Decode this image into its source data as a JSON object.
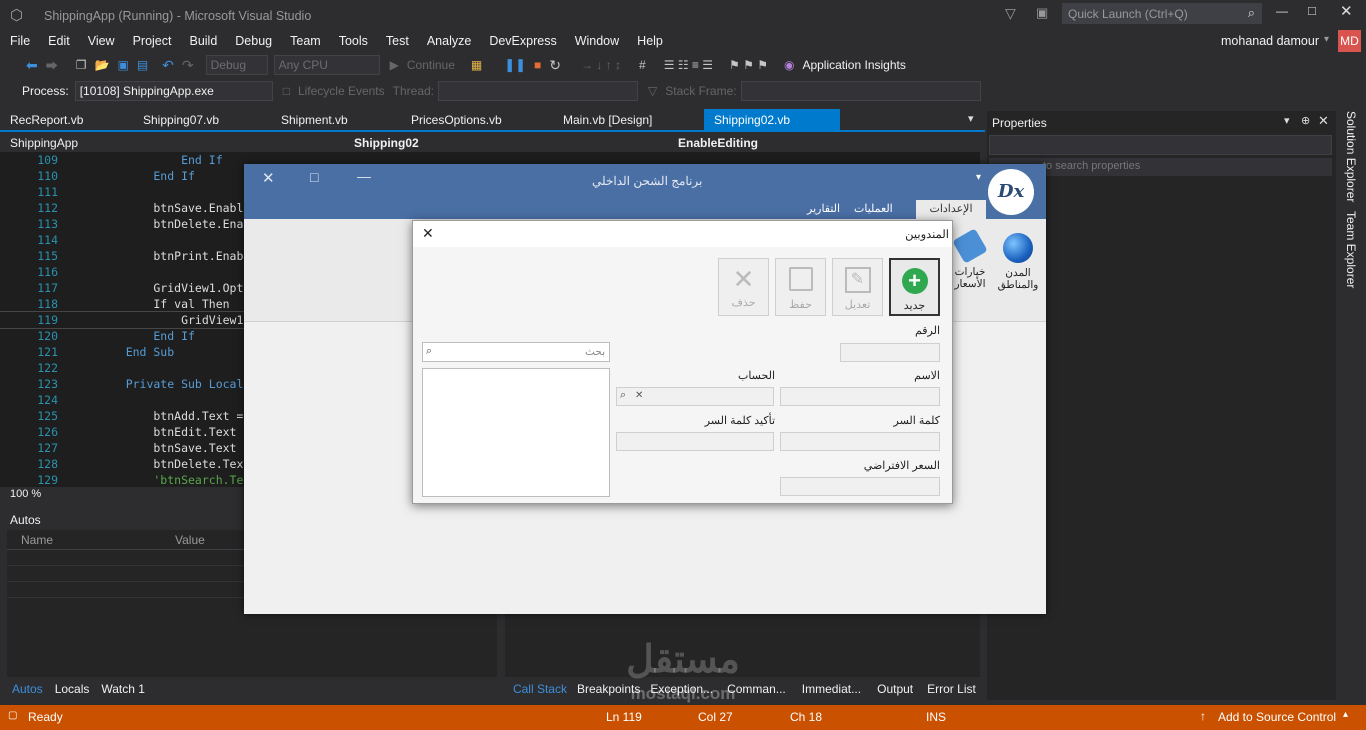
{
  "title_bar": {
    "title": "ShippingApp (Running) - Microsoft Visual Studio",
    "quick_launch_placeholder": "Quick Launch (Ctrl+Q)"
  },
  "menu": [
    "File",
    "Edit",
    "View",
    "Project",
    "Build",
    "Debug",
    "Team",
    "Tools",
    "Test",
    "Analyze",
    "DevExpress",
    "Window",
    "Help"
  ],
  "user": {
    "name": "mohanad damour",
    "initials": "MD"
  },
  "toolbar": {
    "config": "Debug",
    "platform": "Any CPU",
    "continue": "Continue",
    "app_insights": "Application Insights"
  },
  "process_bar": {
    "process_label": "Process:",
    "process_value": "[10108] ShippingApp.exe",
    "lifecycle": "Lifecycle Events",
    "thread_label": "Thread:",
    "stack_frame_label": "Stack Frame:"
  },
  "tabs": [
    {
      "label": "RecReport.vb"
    },
    {
      "label": "Shipping07.vb"
    },
    {
      "label": "Shipment.vb"
    },
    {
      "label": "PricesOptions.vb"
    },
    {
      "label": "Main.vb [Design]"
    },
    {
      "label": "Shipping02.vb"
    }
  ],
  "navbar": {
    "project": "ShippingApp",
    "class": "Shipping02",
    "member": "EnableEditing"
  },
  "editor": {
    "zoom": "100 %",
    "lines": [
      {
        "n": "109",
        "text": "            End If"
      },
      {
        "n": "110",
        "text": "        End If"
      },
      {
        "n": "111",
        "text": ""
      },
      {
        "n": "112",
        "text": "        btnSave.Enabl"
      },
      {
        "n": "113",
        "text": "        btnDelete.Ena"
      },
      {
        "n": "114",
        "text": ""
      },
      {
        "n": "115",
        "text": "        btnPrint.Enab"
      },
      {
        "n": "116",
        "text": ""
      },
      {
        "n": "117",
        "text": "        GridView1.Opt"
      },
      {
        "n": "118",
        "text": "        If val Then"
      },
      {
        "n": "119",
        "text": "            GridView1"
      },
      {
        "n": "120",
        "text": "        End If"
      },
      {
        "n": "121",
        "text": "    End Sub"
      },
      {
        "n": "122",
        "text": ""
      },
      {
        "n": "123",
        "text": "    Private Sub Local"
      },
      {
        "n": "124",
        "text": ""
      },
      {
        "n": "125",
        "text": "        btnAdd.Text ="
      },
      {
        "n": "126",
        "text": "        btnEdit.Text"
      },
      {
        "n": "127",
        "text": "        btnSave.Text"
      },
      {
        "n": "128",
        "text": "        btnDelete.Tex"
      },
      {
        "n": "129",
        "text": "        'btnSearch.Te"
      }
    ]
  },
  "autos": {
    "title": "Autos",
    "col_name": "Name",
    "col_value": "Value"
  },
  "bottom_tabs_left": [
    "Autos",
    "Locals",
    "Watch 1"
  ],
  "bottom_tabs_right": [
    "Call Stack",
    "Breakpoints",
    "Exception...",
    "Comman...",
    "Immediat...",
    "Output",
    "Error List"
  ],
  "properties": {
    "title": "Properties",
    "search_placeholder": "to search properties"
  },
  "side_strip": [
    "Solution Explorer",
    "Team Explorer"
  ],
  "status": {
    "ready": "Ready",
    "ln": "Ln 119",
    "col": "Col 27",
    "ch": "Ch 18",
    "ins": "INS",
    "source_control": "Add to Source Control"
  },
  "app": {
    "title": "برنامج الشحن الداخلي",
    "logo": "Dx",
    "tabs": [
      "الإعدادات",
      "العمليات",
      "التقارير"
    ],
    "ribbon_items": [
      {
        "label": "المدن والمناطق"
      },
      {
        "label": "خيارات الأسعار"
      }
    ]
  },
  "dialog": {
    "title": "المندوبين",
    "buttons": {
      "new": "جديد",
      "edit": "تعديل",
      "save": "حفظ",
      "delete": "حذف"
    },
    "fields": {
      "number": "الرقم",
      "name": "الاسم",
      "account": "الحساب",
      "password": "كلمة السر",
      "confirm_password": "تأكيد كلمة السر",
      "default_price": "السعر الافتراضي"
    },
    "search_placeholder": "بحث"
  },
  "watermark": {
    "text": "مستقل",
    "sub": "mostaql.com"
  }
}
